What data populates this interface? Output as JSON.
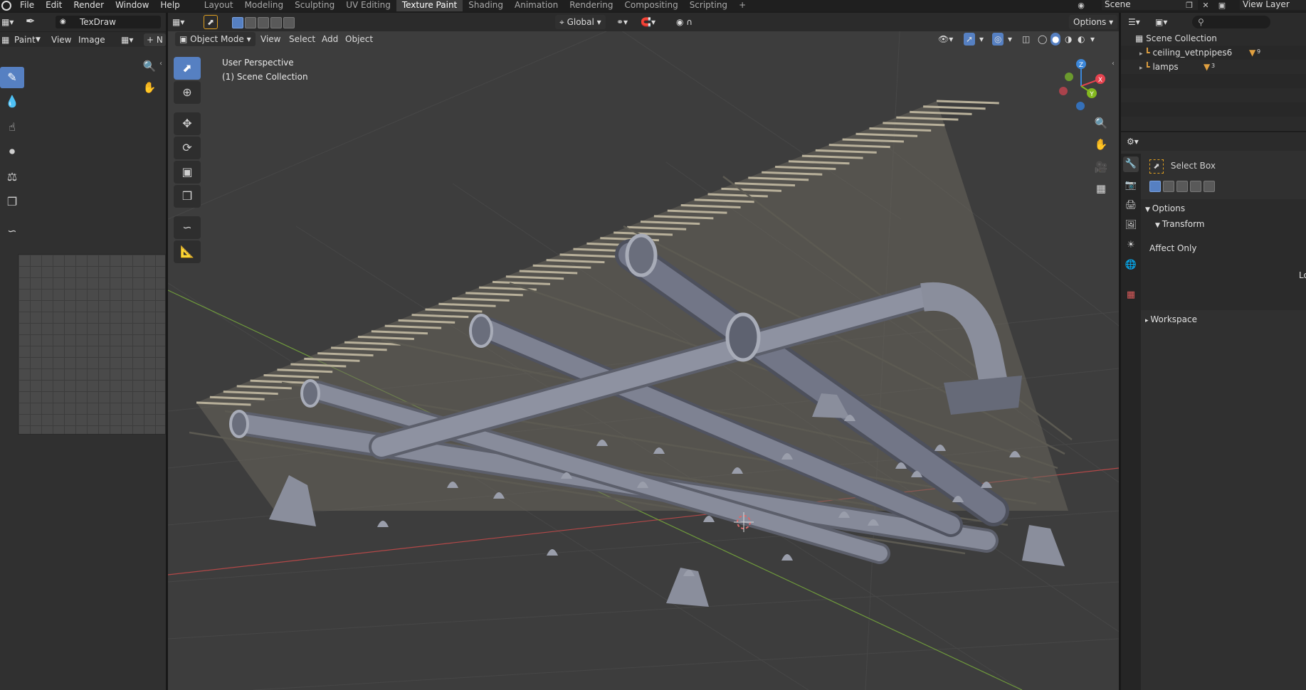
{
  "menubar": {
    "items": [
      "File",
      "Edit",
      "Render",
      "Window",
      "Help"
    ],
    "workspaces": [
      "Layout",
      "Modeling",
      "Sculpting",
      "UV Editing",
      "Texture Paint",
      "Shading",
      "Animation",
      "Rendering",
      "Compositing",
      "Scripting"
    ],
    "active_workspace": "Texture Paint",
    "add_tab": "+",
    "scene_label": "Scene",
    "view_layer_label": "View Layer"
  },
  "image_editor": {
    "brush_name": "TexDraw",
    "mode": "Paint",
    "menus": [
      "View",
      "Image"
    ],
    "new_button": "+",
    "new_button_letter": "N"
  },
  "viewport": {
    "mode": "Object Mode",
    "menus": [
      "View",
      "Select",
      "Add",
      "Object"
    ],
    "transform_orientation": "Global",
    "options_label": "Options",
    "perspective_label": "User Perspective",
    "collection_label": "(1) Scene Collection",
    "gizmo": {
      "x": "X",
      "y": "Y",
      "z": "Z"
    }
  },
  "outliner": {
    "root": "Scene Collection",
    "items": [
      {
        "name": "ceiling_vetnpipes6",
        "badge": "9"
      },
      {
        "name": "lamps",
        "badge": "3"
      }
    ]
  },
  "properties": {
    "active_tool": "Select Box",
    "sections": {
      "options": "Options",
      "transform": "Transform",
      "affect_only": "Affect Only",
      "truncated_label": "Lo",
      "workspace": "Workspace"
    }
  },
  "colors": {
    "accent": "#5680c2",
    "viewport_bg": "#3d3d3d",
    "header_bg": "#2b2b2b",
    "axis_x": "#b34848",
    "axis_y": "#6f9a3c",
    "gizmo_x": "#e6434f",
    "gizmo_y": "#83b81f",
    "gizmo_z": "#3c87d9"
  }
}
